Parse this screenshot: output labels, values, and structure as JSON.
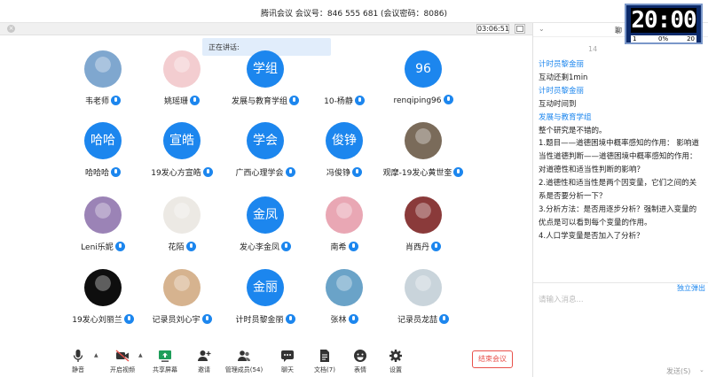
{
  "window": {
    "title": "腾讯会议  会议号：846 555 681   (会议密码：8086)",
    "elapsed": "03:06:51",
    "speaking": "正在讲话:"
  },
  "participants": [
    {
      "name": "韦老师",
      "avatar": "photo",
      "color": "#7fa7cf"
    },
    {
      "name": "姚瑶珊",
      "avatar": "photo",
      "color": "#f3cdd0"
    },
    {
      "name": "发展与教育学组",
      "avatar": "学组"
    },
    {
      "name": "10-杨静",
      "avatar": "none"
    },
    {
      "name": "renqiping96",
      "avatar": "96"
    },
    {
      "name": "哈哈哈",
      "avatar": "哈哈"
    },
    {
      "name": "19发心方宣皓",
      "avatar": "宣皓"
    },
    {
      "name": "广西心理学会",
      "avatar": "学会"
    },
    {
      "name": "冯俊铮",
      "avatar": "俊铮"
    },
    {
      "name": "观摩-19发心黄世奎",
      "avatar": "photo",
      "color": "#7a6b5a"
    },
    {
      "name": "Leni乐妮",
      "avatar": "photo",
      "color": "#9b83b6"
    },
    {
      "name": "花陌",
      "avatar": "photo",
      "color": "#ece9e4"
    },
    {
      "name": "发心李金凤",
      "avatar": "金凤"
    },
    {
      "name": "南希",
      "avatar": "photo",
      "color": "#e9a7b4"
    },
    {
      "name": "肖西丹",
      "avatar": "photo",
      "color": "#8a3a3a"
    },
    {
      "name": "19发心刘丽兰",
      "avatar": "photo",
      "color": "#0e0e0e"
    },
    {
      "name": "记录员刘心宇",
      "avatar": "photo",
      "color": "#d6b38f"
    },
    {
      "name": "计时员黎金丽",
      "avatar": "金丽"
    },
    {
      "name": "张林",
      "avatar": "photo",
      "color": "#6aa3c8"
    },
    {
      "name": "记录员龙喆",
      "avatar": "photo",
      "color": "#c9d4db"
    }
  ],
  "toolbar": {
    "mute": "静音",
    "video": "开启视频",
    "share": "共享屏幕",
    "invite": "邀请",
    "members": "管理成员(54)",
    "chat": "聊天",
    "docs": "文档(7)",
    "reaction": "表情",
    "settings": "设置",
    "end": "结束会议"
  },
  "chat": {
    "header": "聊",
    "time": "14",
    "messages": [
      {
        "sender": "计时员黎金丽",
        "lines": [
          "互动还剩1min"
        ]
      },
      {
        "sender": "计时员黎金丽",
        "lines": [
          "互动时间到"
        ]
      },
      {
        "sender": "发展与教育学组",
        "lines": [
          "整个研究是不错的。",
          "1.题目——道德困境中概率感知的作用： 影响道",
          "当性道德判断——道德困境中概率感知的作用：",
          "对道德性和适当性判断的影响？",
          "2.道德性和适当性是两个因变量，它们之间的关",
          "系是否要分析一下？",
          "3.分析方法：是否用逐步分析？强制进入变量的",
          "优点是可以看到每个变量的作用。",
          "4.人口学变量是否加入了分析？"
        ]
      }
    ],
    "popout": "独立弹出",
    "placeholder": "请输入消息...",
    "send": "发送(S)"
  },
  "clock": {
    "display": "20:00",
    "left": "1",
    "mid": "0%",
    "right": "20"
  },
  "colors": {
    "accent": "#1c86ee",
    "danger": "#e8504a"
  }
}
